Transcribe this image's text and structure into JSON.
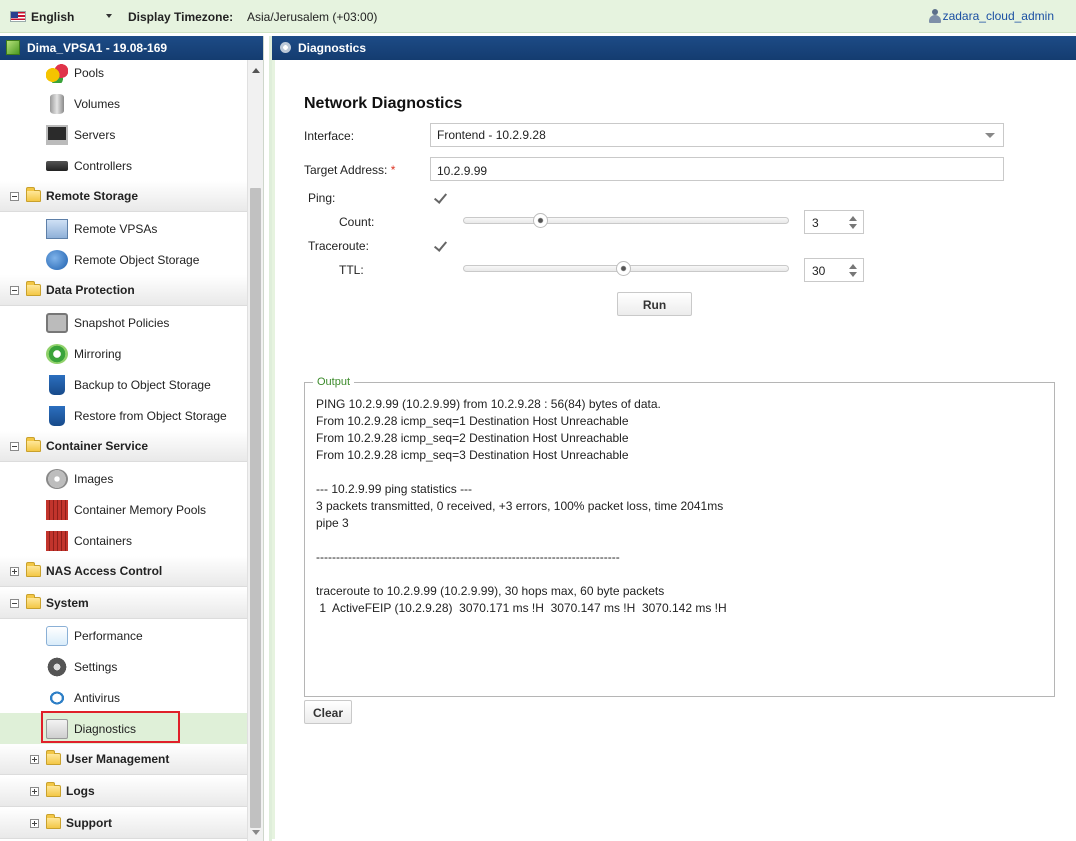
{
  "topbar": {
    "language": "English",
    "timezone_label": "Display Timezone:",
    "timezone_value": "Asia/Jerusalem (+03:00)",
    "user": "zadara_cloud_admin"
  },
  "left": {
    "header": "Dima_VPSA1 - 19.08-169",
    "items": {
      "pools": "Pools",
      "volumes": "Volumes",
      "servers": "Servers",
      "controllers": "Controllers",
      "remote_storage": "Remote Storage",
      "remote_vpsas": "Remote VPSAs",
      "remote_object_storage": "Remote Object Storage",
      "data_protection": "Data Protection",
      "snapshot_policies": "Snapshot Policies",
      "mirroring": "Mirroring",
      "backup": "Backup to Object Storage",
      "restore": "Restore from Object Storage",
      "container_service": "Container Service",
      "images": "Images",
      "container_memory_pools": "Container Memory Pools",
      "containers": "Containers",
      "nas_access_control": "NAS Access Control",
      "system": "System",
      "performance": "Performance",
      "settings": "Settings",
      "antivirus": "Antivirus",
      "diagnostics": "Diagnostics",
      "user_management": "User Management",
      "logs": "Logs",
      "support": "Support"
    }
  },
  "right": {
    "header": "Diagnostics",
    "title": "Network Diagnostics",
    "interface_label": "Interface:",
    "interface_value": "Frontend - 10.2.9.28",
    "target_label": "Target Address:",
    "target_required": "*",
    "target_value": "10.2.9.99",
    "ping_label": "Ping:",
    "ping_checked": true,
    "count_label": "Count:",
    "count_value": "3",
    "count_slider_fraction": 0.235,
    "traceroute_label": "Traceroute:",
    "traceroute_checked": true,
    "ttl_label": "TTL:",
    "ttl_value": "30",
    "ttl_slider_fraction": 0.49,
    "run_label": "Run",
    "output_legend": "Output",
    "output_text": "PING 10.2.9.99 (10.2.9.99) from 10.2.9.28 : 56(84) bytes of data.\nFrom 10.2.9.28 icmp_seq=1 Destination Host Unreachable\nFrom 10.2.9.28 icmp_seq=2 Destination Host Unreachable\nFrom 10.2.9.28 icmp_seq=3 Destination Host Unreachable\n\n--- 10.2.9.99 ping statistics ---\n3 packets transmitted, 0 received, +3 errors, 100% packet loss, time 2041ms\npipe 3\n\n----------------------------------------------------------------------------\n\ntraceroute to 10.2.9.99 (10.2.9.99), 30 hops max, 60 byte packets\n 1  ActiveFEIP (10.2.9.28)  3070.171 ms !H  3070.147 ms !H  3070.142 ms !H",
    "clear_label": "Clear"
  }
}
